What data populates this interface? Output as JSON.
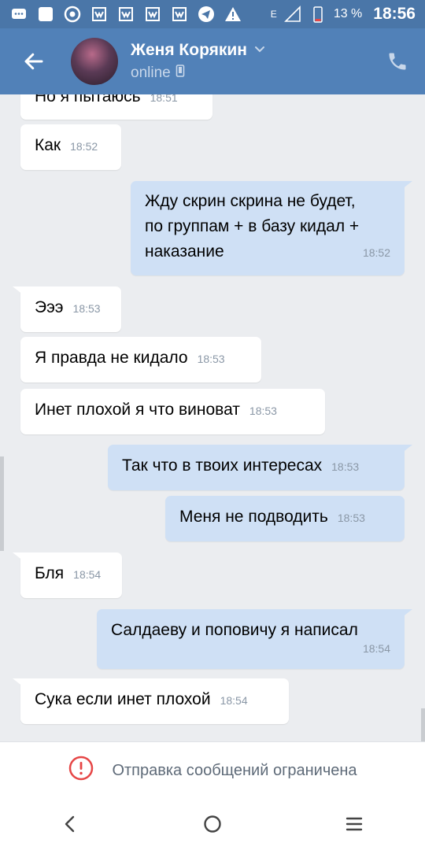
{
  "status_bar": {
    "battery_percent": "13 %",
    "time": "18:56",
    "network_label": "E",
    "left_icons": [
      "chat-icon",
      "message-icon",
      "chrome-icon",
      "vk-icon",
      "vk-icon",
      "vk-icon",
      "vk-icon",
      "telegram-icon",
      "warning-icon"
    ]
  },
  "header": {
    "contact_name": "Женя Корякин",
    "status": "online"
  },
  "messages": [
    {
      "dir": "in",
      "text": "Но я пытаюсь",
      "time": "18:51"
    },
    {
      "dir": "in",
      "text": "Как",
      "time": "18:52"
    },
    {
      "dir": "out",
      "lines": [
        "Жду скрин скрина не будет,",
        "по группам + в базу кидал +",
        "наказание"
      ],
      "time": "18:52"
    },
    {
      "dir": "in",
      "text": "Эээ",
      "time": "18:53"
    },
    {
      "dir": "in",
      "text": "Я правда не кидало",
      "time": "18:53"
    },
    {
      "dir": "in",
      "text": "Инет плохой я что виноват",
      "time": "18:53"
    },
    {
      "dir": "out",
      "text": "Так что в твоих интересах",
      "time": "18:53"
    },
    {
      "dir": "out",
      "text": "Меня не подводить",
      "time": "18:53"
    },
    {
      "dir": "in",
      "text": "Бля",
      "time": "18:54"
    },
    {
      "dir": "out",
      "text": "Салдаеву и поповичу я написал",
      "time": "18:54"
    },
    {
      "dir": "in",
      "text": "Сука если инет плохой",
      "time": "18:54"
    }
  ],
  "restricted_notice": "Отправка сообщений ограничена",
  "colors": {
    "header_bg": "#5181b8",
    "statusbar_bg": "#4a76a8",
    "chat_bg": "#ebedf0",
    "incoming_bubble": "#ffffff",
    "outgoing_bubble": "#cfe0f5",
    "warning_red": "#e64646"
  }
}
